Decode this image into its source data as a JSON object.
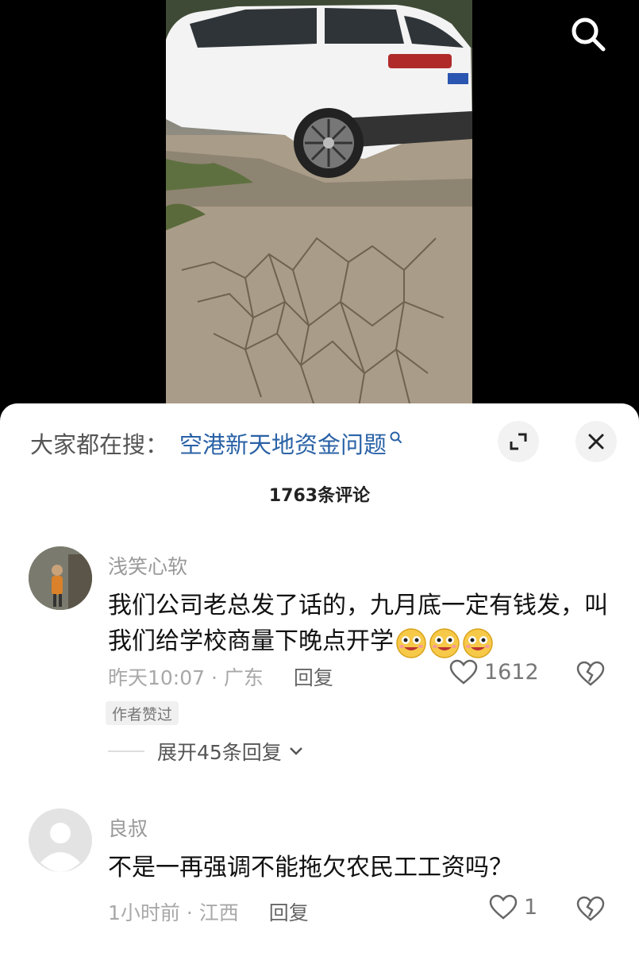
{
  "icons": {
    "search": "search-icon",
    "expand": "expand-icon",
    "close": "close-icon",
    "like": "heart-outline-icon",
    "dislike": "broken-heart-icon",
    "emoji": "grinning-face-icon",
    "chevron": "chevron-down-icon"
  },
  "hot_search": {
    "prefix": "大家都在搜：",
    "query": "空港新天地资金问题"
  },
  "comments_count": "1763条评论",
  "comments": [
    {
      "username": "浅笑心软",
      "text": "我们公司老总发了话的，九月底一定有钱发，叫我们给学校商量下晚点开学",
      "emoji_count": 3,
      "time": "昨天10:07 · 广东",
      "reply_label": "回复",
      "likes": "1612",
      "author_liked": "作者赞过",
      "expand_replies": "展开45条回复"
    },
    {
      "username": "良叔",
      "text": "不是一再强调不能拖欠农民工工资吗？",
      "time": "1小时前 · 江西",
      "reply_label": "回复",
      "likes": "1"
    }
  ],
  "colors": {
    "link": "#2a62a6",
    "background": "#ffffff",
    "muted_text": "#a8a8a8"
  }
}
